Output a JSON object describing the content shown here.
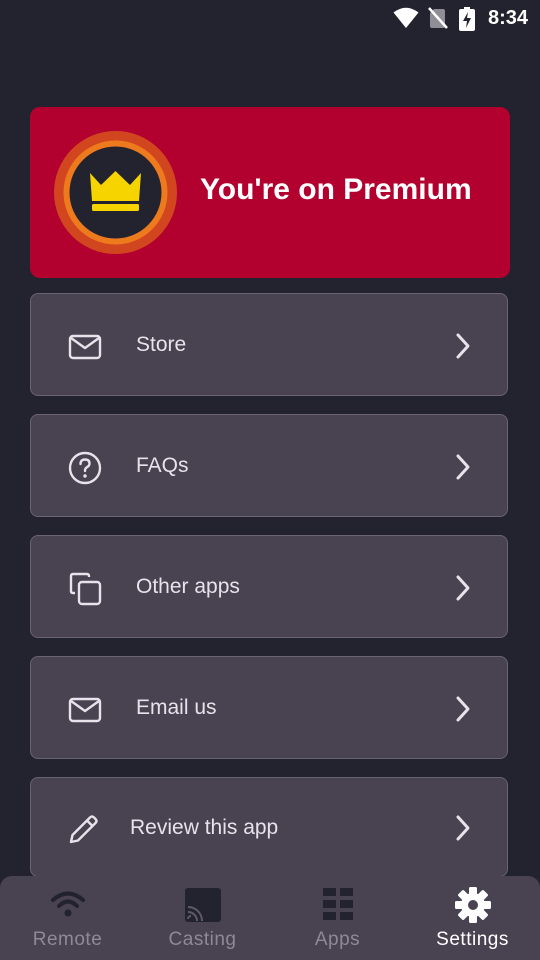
{
  "status_bar": {
    "time": "8:34",
    "icons": [
      "wifi-icon",
      "no-sim-icon",
      "battery-charging-icon"
    ]
  },
  "premium": {
    "title": "You're on Premium",
    "icon": "crown-icon",
    "colors": {
      "card": "#b2002f",
      "ring": "#d2461f",
      "inner_ring": "#ee7a1e",
      "crown": "#f5d400"
    }
  },
  "menu": {
    "items": [
      {
        "label": "Store",
        "icon": "mail-icon"
      },
      {
        "label": "FAQs",
        "icon": "help-circle-icon"
      },
      {
        "label": "Other apps",
        "icon": "copy-icon"
      },
      {
        "label": "Email us",
        "icon": "mail-icon"
      },
      {
        "label": "Review this app",
        "icon": "pencil-icon"
      }
    ]
  },
  "bottom_nav": {
    "items": [
      {
        "label": "Remote",
        "icon": "wifi-remote-icon"
      },
      {
        "label": "Casting",
        "icon": "cast-icon"
      },
      {
        "label": "Apps",
        "icon": "grid-icon"
      },
      {
        "label": "Settings",
        "icon": "gear-icon",
        "active": true
      }
    ]
  },
  "colors": {
    "background": "#23222f",
    "card": "#494251",
    "text": "#e7e3ea",
    "inactive_nav": "#8f8996"
  }
}
